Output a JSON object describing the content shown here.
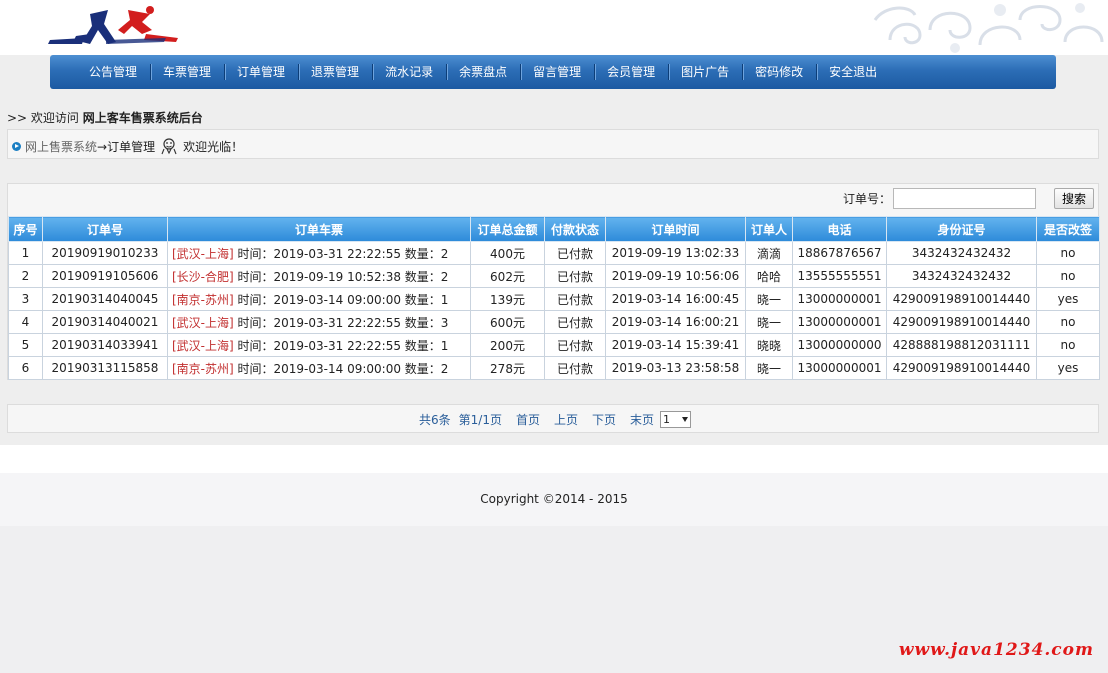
{
  "brand": {
    "logo_icon": "running-figures-logo",
    "accent": "#2c6db6",
    "route_color": "#c23030",
    "watermark_color": "#e01818"
  },
  "nav": {
    "items": [
      {
        "label": "公告管理"
      },
      {
        "label": "车票管理"
      },
      {
        "label": "订单管理"
      },
      {
        "label": "退票管理"
      },
      {
        "label": "流水记录"
      },
      {
        "label": "余票盘点"
      },
      {
        "label": "留言管理"
      },
      {
        "label": "会员管理"
      },
      {
        "label": "图片广告"
      },
      {
        "label": "密码修改"
      },
      {
        "label": "安全退出"
      }
    ]
  },
  "welcome": {
    "prefix": ">> 欢迎访问",
    "site": "网上客车售票系统后台"
  },
  "breadcrumb": {
    "home": "网上售票系统",
    "current": "→订单管理",
    "greeting": "欢迎光临！",
    "icon": "cartoon-mascot-icon"
  },
  "search": {
    "label": "订单号：",
    "value": "",
    "placeholder": "",
    "button": "搜索"
  },
  "table": {
    "headers": [
      "序号",
      "订单号",
      "订单车票",
      "订单总金额",
      "付款状态",
      "订单时间",
      "订单人",
      "电话",
      "身份证号",
      "是否改签"
    ],
    "rows": [
      {
        "idx": "1",
        "order_no": "20190919010233",
        "route": "[武汉-上海]",
        "ticket": " 时间：2019-03-31 22:22:55 数量：2",
        "amount": "400元",
        "status": "已付款",
        "time": "2019-09-19 13:02:33",
        "person": "滴滴",
        "phone": "18867876567",
        "id_no": "3432432432432",
        "changed": "no"
      },
      {
        "idx": "2",
        "order_no": "20190919105606",
        "route": "[长沙-合肥]",
        "ticket": " 时间：2019-09-19 10:52:38 数量：2",
        "amount": "602元",
        "status": "已付款",
        "time": "2019-09-19 10:56:06",
        "person": "哈哈",
        "phone": "13555555551",
        "id_no": "3432432432432",
        "changed": "no"
      },
      {
        "idx": "3",
        "order_no": "20190314040045",
        "route": "[南京-苏州]",
        "ticket": " 时间：2019-03-14 09:00:00 数量：1",
        "amount": "139元",
        "status": "已付款",
        "time": "2019-03-14 16:00:45",
        "person": "晓一",
        "phone": "13000000001",
        "id_no": "429009198910014440",
        "changed": "yes"
      },
      {
        "idx": "4",
        "order_no": "20190314040021",
        "route": "[武汉-上海]",
        "ticket": " 时间：2019-03-31 22:22:55 数量：3",
        "amount": "600元",
        "status": "已付款",
        "time": "2019-03-14 16:00:21",
        "person": "晓一",
        "phone": "13000000001",
        "id_no": "429009198910014440",
        "changed": "no"
      },
      {
        "idx": "5",
        "order_no": "20190314033941",
        "route": "[武汉-上海]",
        "ticket": " 时间：2019-03-31 22:22:55 数量：1",
        "amount": "200元",
        "status": "已付款",
        "time": "2019-03-14 15:39:41",
        "person": "晓晓",
        "phone": "13000000000",
        "id_no": "428888198812031111",
        "changed": "no"
      },
      {
        "idx": "6",
        "order_no": "20190313115858",
        "route": "[南京-苏州]",
        "ticket": " 时间：2019-03-14 09:00:00 数量：2",
        "amount": "278元",
        "status": "已付款",
        "time": "2019-03-13 23:58:58",
        "person": "晓一",
        "phone": "13000000001",
        "id_no": "429009198910014440",
        "changed": "yes"
      }
    ]
  },
  "pager": {
    "total": "共6条",
    "page": "第1/1页",
    "first": "首页",
    "prev": "上页",
    "next": "下页",
    "last": "末页",
    "selected": "1"
  },
  "footer": {
    "copyright": "Copyright ©2014 - 2015"
  },
  "watermark": "www.java1234.com"
}
